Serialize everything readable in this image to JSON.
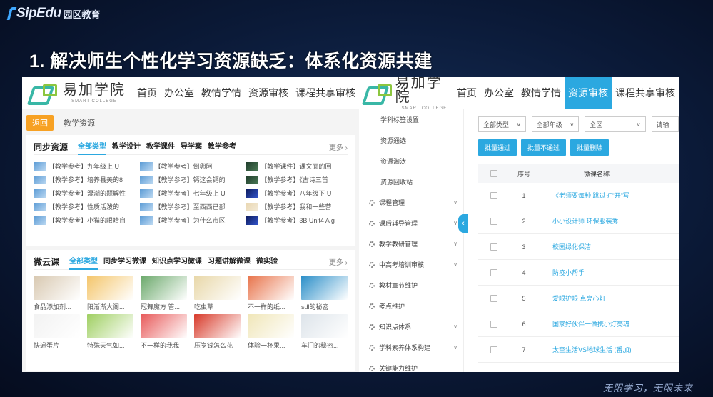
{
  "brand": {
    "name": "SipEdu",
    "name_cn": "园区教育"
  },
  "slide_title": "1. 解决师生个性化学习资源缺乏：体系化资源共建",
  "slogan": "无限学习，无限未来",
  "site": {
    "logo_cn": "易加学院",
    "logo_en": "SMART COLLEGE"
  },
  "left": {
    "nav": [
      "首页",
      "办公室",
      "教情学情",
      "资源审核",
      "课程共享审核"
    ],
    "back_label": "返回",
    "crumb": "教学资源",
    "sync": {
      "title": "同步资源",
      "tabs": [
        "全部类型",
        "教学设计",
        "教学课件",
        "导学案",
        "教学参考"
      ],
      "more": "更多",
      "items": [
        {
          "text": "【教学参考】九年级上 U",
          "thumb": "b"
        },
        {
          "text": "【教学参考】倒卵阿",
          "thumb": "b"
        },
        {
          "text": "【教学课件】课文面的回",
          "thumb": "d"
        },
        {
          "text": "【教学参考】培养县美的8",
          "thumb": "b"
        },
        {
          "text": "【教学参考】钙这会钙的",
          "thumb": "b"
        },
        {
          "text": "【教学参考】《古诗三首",
          "thumb": "d"
        },
        {
          "text": "【教学参考】湿潮的题解性",
          "thumb": "b"
        },
        {
          "text": "【教学参考】七年级上 U",
          "thumb": "b"
        },
        {
          "text": "【教学参考】八年级下 U",
          "thumb": "n"
        },
        {
          "text": "【教学参考】性质活泼的",
          "thumb": "b"
        },
        {
          "text": "【教学参考】至西西已部",
          "thumb": "b"
        },
        {
          "text": "【教学参考】我和一些营",
          "thumb": "r"
        },
        {
          "text": "【教学参考】小猫的眼睛自",
          "thumb": "b"
        },
        {
          "text": "【教学参考】为什么市区",
          "thumb": "b"
        },
        {
          "text": "【教学参考】3B Unit4 A g",
          "thumb": "n"
        }
      ]
    },
    "micro": {
      "title": "微云课",
      "tabs": [
        "全部类型",
        "同步学习微课",
        "知识点学习微课",
        "习题讲解微课",
        "微实验"
      ],
      "more": "更多",
      "items": [
        {
          "caption": "食品添加剂...",
          "color": "#d8c8b0"
        },
        {
          "caption": "阳渐渐大阁...",
          "color": "#f4c56a"
        },
        {
          "caption": "冠舞魔方 管...",
          "color": "#6aa86a"
        },
        {
          "caption": "吃虫草",
          "color": "#e8d7a8"
        },
        {
          "caption": "不一样的纸...",
          "color": "#e8734a"
        },
        {
          "caption": "sdl的秘密",
          "color": "#2a8ec8"
        },
        {
          "caption": "快递蛋片",
          "color": "#f2f2f2"
        },
        {
          "caption": "特殊天气如...",
          "color": "#9fcf62"
        },
        {
          "caption": "不一样的我我",
          "color": "#e85a5a"
        },
        {
          "caption": "压岁钱怎么花",
          "color": "#d83a2a"
        },
        {
          "caption": "体验一杯果...",
          "color": "#f0e6b8"
        },
        {
          "caption": "车门的秘密...",
          "color": "#dde4ea"
        }
      ]
    }
  },
  "right": {
    "nav": [
      "首页",
      "办公室",
      "教情学情",
      "资源审核",
      "课程共享审核"
    ],
    "active_nav": "资源审核",
    "sidebar": [
      {
        "label": "学科标签设置",
        "sub": true,
        "chev": false
      },
      {
        "label": "资源通选",
        "sub": true,
        "chev": false
      },
      {
        "label": "资源淘汰",
        "sub": true,
        "chev": false
      },
      {
        "label": "资源回收站",
        "sub": true,
        "chev": false
      },
      {
        "label": "课程管理",
        "sub": false,
        "chev": true
      },
      {
        "label": "课后辅导管理",
        "sub": false,
        "chev": true
      },
      {
        "label": "教学教研管理",
        "sub": false,
        "chev": true
      },
      {
        "label": "中高考培训审核",
        "sub": false,
        "chev": true
      },
      {
        "label": "教材章节维护",
        "sub": false,
        "chev": false
      },
      {
        "label": "考点维护",
        "sub": false,
        "chev": false
      },
      {
        "label": "知识点体系",
        "sub": false,
        "chev": true
      },
      {
        "label": "学科素养体系构建",
        "sub": false,
        "chev": true
      },
      {
        "label": "关键能力维护",
        "sub": false,
        "chev": false
      }
    ],
    "filters": [
      "全部类型",
      "全部年级",
      "全区",
      "请输"
    ],
    "buttons": [
      "批量通过",
      "批量不通过",
      "批量删除"
    ],
    "table": {
      "headers": [
        "序号",
        "微课名称"
      ],
      "rows": [
        {
          "no": "1",
          "name": "《老师要每种 跳过扩\"开\"写"
        },
        {
          "no": "2",
          "name": "小小设计师 环保服装秀"
        },
        {
          "no": "3",
          "name": "校园绿化保洁"
        },
        {
          "no": "4",
          "name": "防疫小帮手"
        },
        {
          "no": "5",
          "name": "爱眼护眼 点亮心灯"
        },
        {
          "no": "6",
          "name": "国家好伙伴一做携小灯亮魂"
        },
        {
          "no": "7",
          "name": "太空生活VS地球生活 (番加)"
        }
      ]
    }
  }
}
